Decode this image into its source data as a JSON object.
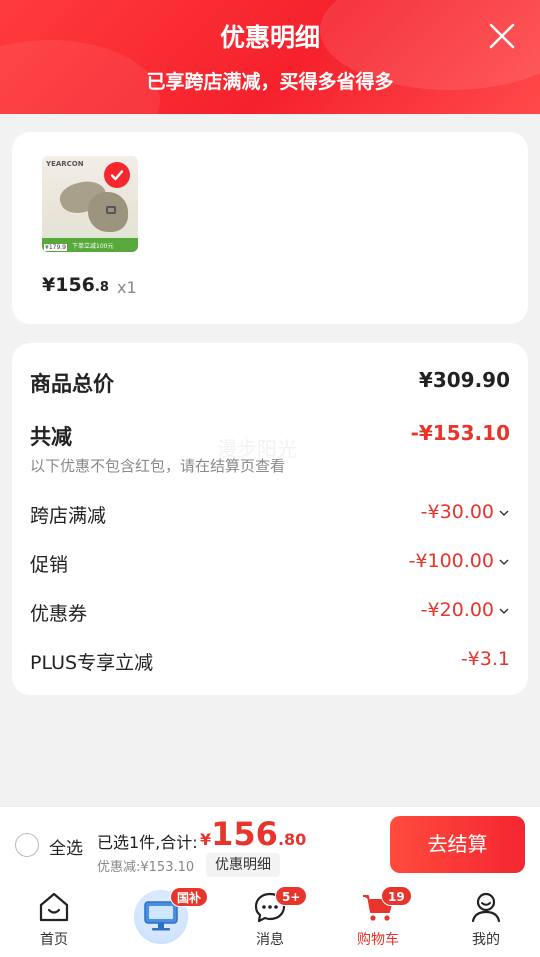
{
  "header": {
    "title": "优惠明细",
    "subtitle": "已享跨店满减，买得多省得多"
  },
  "item": {
    "image_brand": "YEARCON",
    "image_price": "¥179.9",
    "image_strip": "下单立减100元",
    "price_int": "¥156",
    "price_dec": ".8",
    "qty": "x1"
  },
  "breakdown": {
    "total_label": "商品总价",
    "total_value": "¥309.90",
    "reduce_label": "共减",
    "reduce_value": "-¥153.10",
    "note": "以下优惠不包含红包，请在结算页查看",
    "watermark": "漫步阳光",
    "rows": [
      {
        "label": "跨店满减",
        "value": "-¥30.00"
      },
      {
        "label": "促销",
        "value": "-¥100.00"
      },
      {
        "label": "优惠券",
        "value": "-¥20.00"
      },
      {
        "label": "PLUS专享立减",
        "value": "-¥3.1"
      }
    ]
  },
  "bottom": {
    "select_all": "全选",
    "summary": "已选1件,合计:",
    "total_currency": "¥",
    "total_int": "156",
    "total_dec": ".80",
    "discount": "优惠减:¥153.10",
    "detail_btn": "优惠明细",
    "checkout": "去结算"
  },
  "tabbar": {
    "tabs": [
      {
        "label": "首页",
        "icon": "home-icon"
      },
      {
        "label": "",
        "icon": "gov-subsidy-icon",
        "badge": "国补"
      },
      {
        "label": "消息",
        "icon": "message-icon",
        "badge": "5+"
      },
      {
        "label": "购物车",
        "icon": "cart-icon",
        "badge": "19"
      },
      {
        "label": "我的",
        "icon": "profile-icon"
      }
    ]
  },
  "colors": {
    "accent": "#e8352b",
    "header": "#f5212c"
  }
}
